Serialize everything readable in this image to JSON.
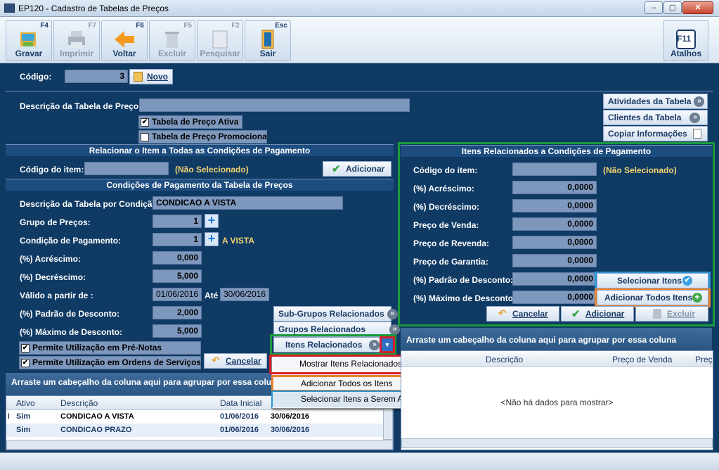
{
  "window": {
    "title": "EP120 - Cadastro de Tabelas de Preços",
    "min": "–",
    "max": "▢",
    "close": "✕"
  },
  "toolbar": [
    {
      "key": "F4",
      "label": "Gravar"
    },
    {
      "key": "F7",
      "label": "Imprimir"
    },
    {
      "key": "F6",
      "label": "Voltar"
    },
    {
      "key": "F5",
      "label": "Excluir"
    },
    {
      "key": "F2",
      "label": "Pesquisar"
    },
    {
      "key": "Esc",
      "label": "Sair"
    },
    {
      "key": "F11",
      "label": "Atalhos"
    }
  ],
  "codigo": {
    "label": "Código:",
    "value": "3",
    "novo": "Novo"
  },
  "descricao": {
    "label": "Descrição da Tabela de Preço:",
    "value": "",
    "ativa": "Tabela de Preço Ativa",
    "promocional": "Tabela de Preço Promocional"
  },
  "side_buttons": {
    "atividades": "Atividades da Tabela",
    "clientes": "Clientes da Tabela",
    "copiar": "Copiar Informações"
  },
  "relacionar": {
    "header": "Relacionar o Item a Todas as Condições de Pagamento",
    "codigo_label": "Código do item:",
    "nao_sel": "(Não Selecionado)",
    "adicionar": "Adicionar"
  },
  "condicoes": {
    "header": "Condições de Pagamento da Tabela de Preços",
    "desc_label": "Descrição da Tabela por Condição:",
    "desc_value": "CONDICAO A VISTA",
    "grupo_label": "Grupo de Preços:",
    "grupo_value": "1",
    "cond_label": "Condição de Pagamento:",
    "cond_value": "1",
    "cond_text": "A VISTA",
    "acr_label": "(%) Acréscimo:",
    "acr_value": "0,000",
    "dec_label": "(%) Decréscimo:",
    "dec_value": "5,000",
    "valido_label": "Válido a  partir de :",
    "valido_de": "01/06/2016",
    "ate": "Até",
    "valido_ate": "30/06/2016",
    "padrao_label": "(%) Padrão de Desconto:",
    "padrao_value": "2,000",
    "max_label": "(%) Máximo de Desconto:",
    "max_value": "5,000",
    "pre_notas": "Permite Utilização em Pré-Notas",
    "ordens": "Permite Utilização em Ordens de Serviços",
    "subgrupos": "Sub-Grupos Relacionados",
    "grupos": "Grupos Relacionados",
    "itens": "Itens Relacionados",
    "cancelar": "Cancelar"
  },
  "menu": {
    "mostrar": "Mostrar  Itens Relacionados",
    "adicionar_todos": "Adicionar Todos os Itens",
    "selecionar": "Selecionar Itens a Serem Adicionados"
  },
  "left_grid": {
    "groupbar": "Arraste um cabeçalho da coluna aqui para agrupar por essa coluna",
    "columns": [
      "Ativo",
      "Descrição",
      "Data Inicial"
    ],
    "rows": [
      {
        "ativo": "Sim",
        "descricao": "CONDICAO A VISTA",
        "inicio": "01/06/2016",
        "fim": "30/06/2016"
      },
      {
        "ativo": "Sim",
        "descricao": "CONDICAO PRAZO",
        "inicio": "01/06/2016",
        "fim": "30/06/2016"
      }
    ]
  },
  "itens_rel": {
    "header": "Itens Relacionados a Condições de Pagamento",
    "codigo_label": "Código do item:",
    "nao_sel": "(Não Selecionado)",
    "acr_label": "(%) Acréscimo:",
    "acr_value": "0,0000",
    "dec_label": "(%) Decréscimo:",
    "dec_value": "0,0000",
    "venda_label": "Preço de Venda:",
    "venda_value": "0,0000",
    "revenda_label": "Preço de Revenda:",
    "revenda_value": "0,0000",
    "garantia_label": "Preço de Garantia:",
    "garantia_value": "0,0000",
    "padrao_label": "(%) Padrão de Desconto:",
    "padrao_value": "0,0000",
    "max_label": "(%) Máximo de Desconto:",
    "max_value": "0,0000",
    "selecionar": "Selecionar Itens",
    "adicionar_todos": "Adicionar Todos Itens",
    "cancelar": "Cancelar",
    "adicionar": "Adicionar",
    "excluir": "Excluir"
  },
  "right_grid": {
    "groupbar": "Arraste um cabeçalho da coluna aqui para agrupar por essa coluna",
    "columns": [
      "Descrição",
      "Preço de Venda",
      "Preç"
    ],
    "empty": "<Não há dados para mostrar>"
  }
}
